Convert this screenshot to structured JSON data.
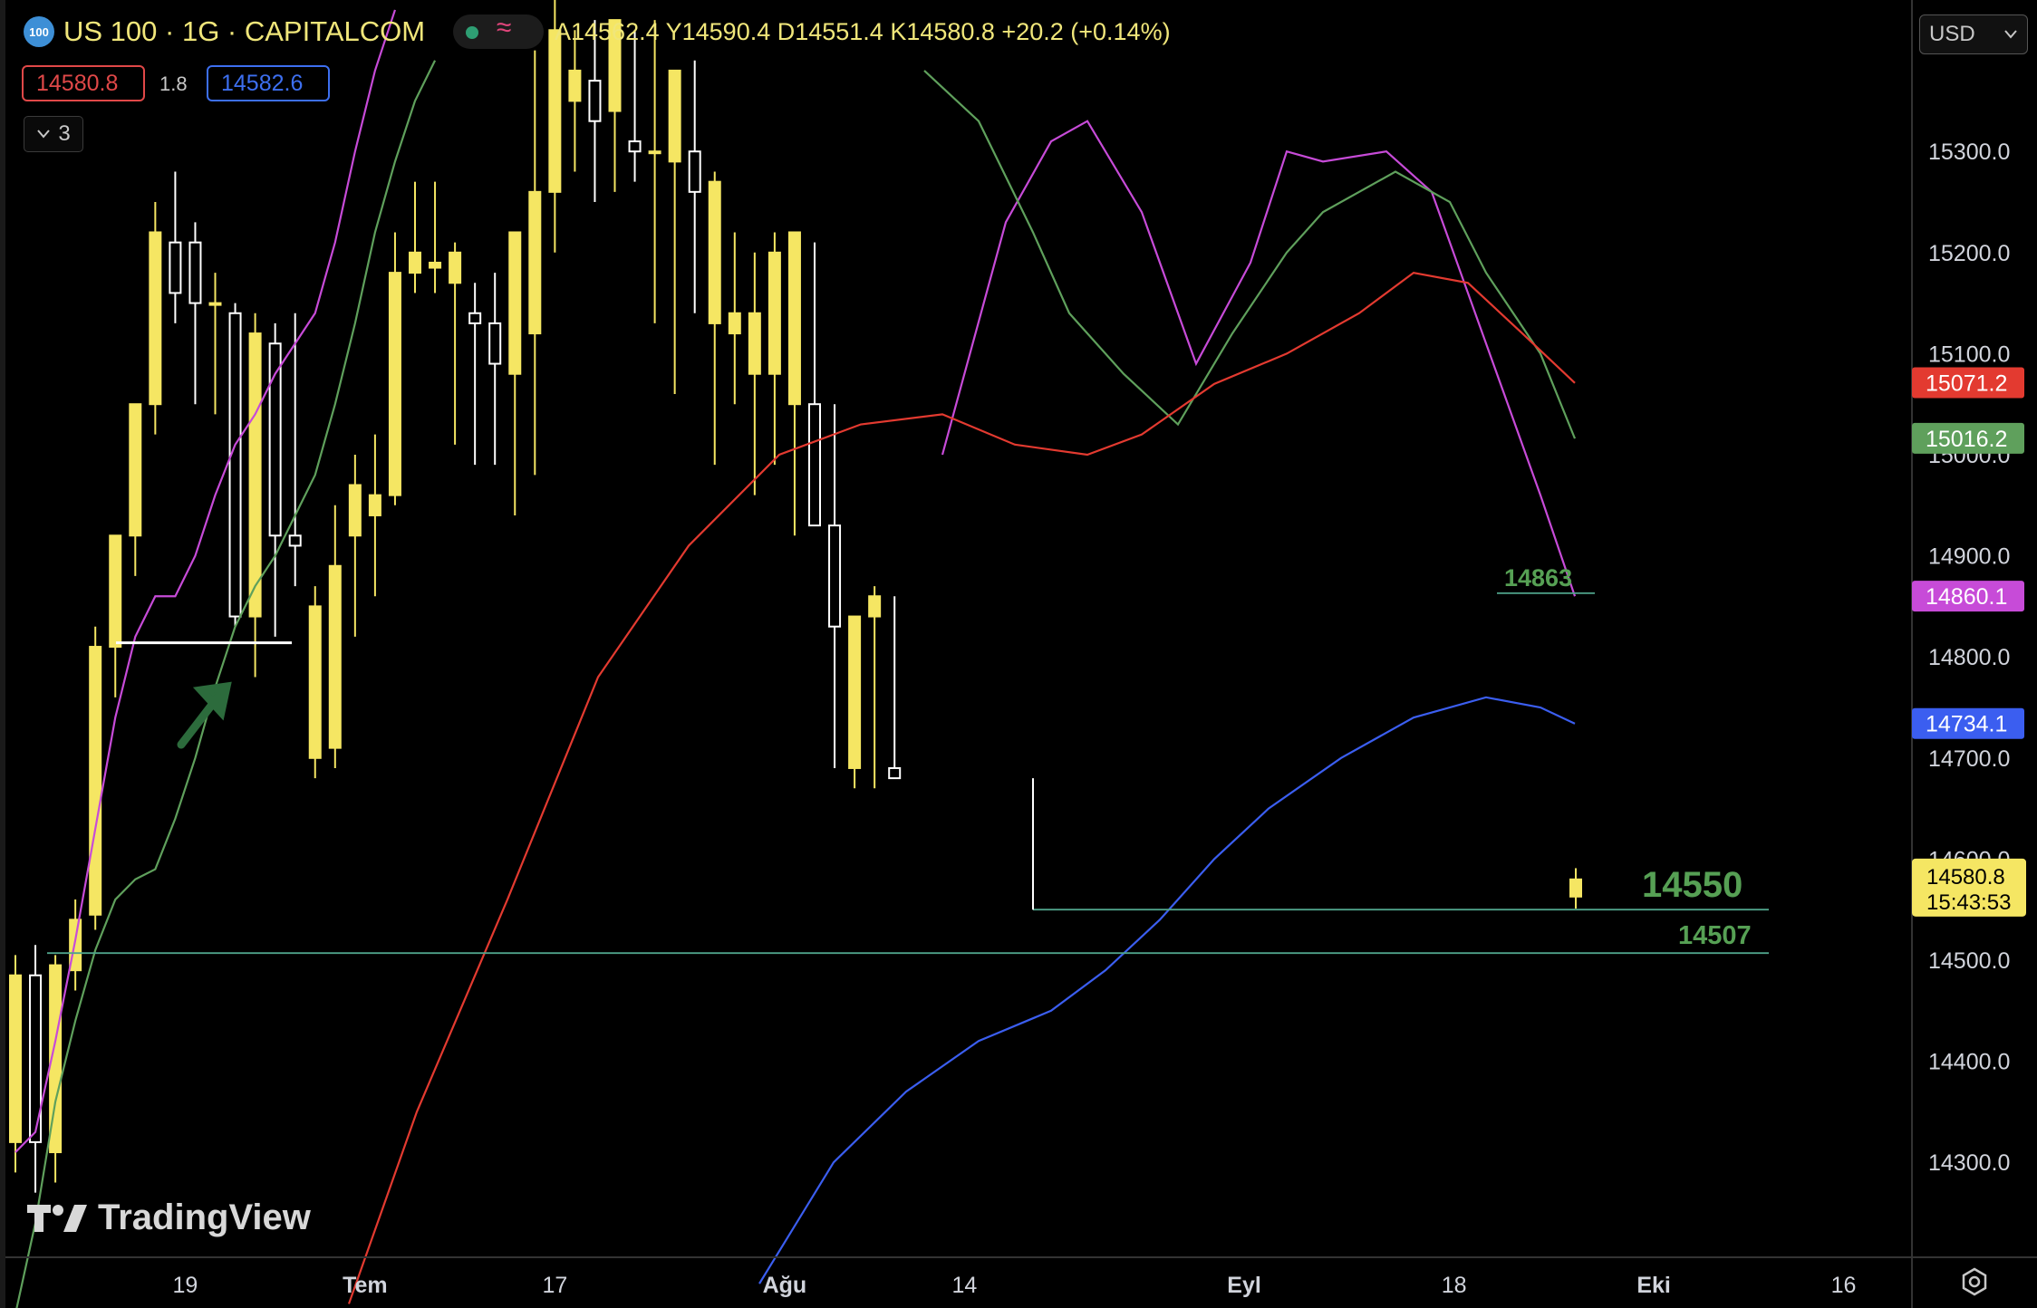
{
  "header": {
    "logo_text": "100",
    "title": "US 100 · 1G · CAPITALCOM",
    "ohlc": "A14562.4  Y14590.4  D14551.4  K14580.8  +20.2 (+0.14%)",
    "bid": "14580.8",
    "spread": "1.8",
    "ask": "14582.6",
    "indicator_count": "3",
    "currency": "USD",
    "brand": "TradingView"
  },
  "colors": {
    "bull": "#f5e663",
    "bear_body": "#000000",
    "wick": "#ffffff",
    "ema_fast": "#c74bd8",
    "ema_mid": "#5fa05c",
    "ema_slow": "#e33a30",
    "ema_long": "#3b5ef0",
    "level": "#4fa38a",
    "label_green": "#56a054"
  },
  "chart_data": {
    "type": "candlestick",
    "symbol": "US 100",
    "timeframe": "1G",
    "y_ticks": [
      14300,
      14400,
      14500,
      14600,
      14700,
      14800,
      14900,
      15000,
      15100,
      15200,
      15300
    ],
    "y_tick_labels": [
      "14300.0",
      "14400.0",
      "14500.0",
      "14600.0",
      "14700.0",
      "14800.0",
      "14900.0",
      "15000.0",
      "15100.0",
      "15200.0",
      "15300.0"
    ],
    "ylim": [
      14204,
      15445
    ],
    "x_labels": [
      {
        "label": "19",
        "bar": 8.5,
        "bold": false
      },
      {
        "label": "Tem",
        "bar": 17.5,
        "bold": true
      },
      {
        "label": "17",
        "bar": 27,
        "bold": false
      },
      {
        "label": "Ağu",
        "bar": 38.5,
        "bold": true
      },
      {
        "label": "14",
        "bar": 47.5,
        "bold": false
      },
      {
        "label": "Eyl",
        "bar": 61.5,
        "bold": true
      },
      {
        "label": "18",
        "bar": 72,
        "bold": false
      },
      {
        "label": "Eki",
        "bar": 82,
        "bold": true
      },
      {
        "label": "16",
        "bar": 91.5,
        "bold": false
      }
    ],
    "candles": [
      [
        14320,
        14505,
        14290,
        14485
      ],
      [
        14485,
        14515,
        14270,
        14320
      ],
      [
        14310,
        14505,
        14280,
        14495
      ],
      [
        14490,
        14560,
        14470,
        14540
      ],
      [
        14545,
        14830,
        14530,
        14810
      ],
      [
        14810,
        14920,
        14760,
        14920
      ],
      [
        14920,
        15050,
        14880,
        15050
      ],
      [
        15050,
        15250,
        15020,
        15220
      ],
      [
        15210,
        15280,
        15130,
        15160
      ],
      [
        15210,
        15230,
        15050,
        15150
      ],
      [
        15150,
        15180,
        15040,
        15150
      ],
      [
        15140,
        15150,
        14830,
        14840
      ],
      [
        14840,
        15140,
        14780,
        15120
      ],
      [
        15110,
        15130,
        14820,
        14920
      ],
      [
        14920,
        15140,
        14870,
        14910
      ],
      [
        14700,
        14870,
        14680,
        14850
      ],
      [
        14710,
        14950,
        14690,
        14890
      ],
      [
        14920,
        15000,
        14820,
        14970
      ],
      [
        14940,
        15020,
        14860,
        14960
      ],
      [
        14960,
        15220,
        14950,
        15180
      ],
      [
        15180,
        15270,
        15160,
        15200
      ],
      [
        15185,
        15270,
        15160,
        15190
      ],
      [
        15170,
        15210,
        15010,
        15200
      ],
      [
        15140,
        15170,
        14990,
        15130
      ],
      [
        15130,
        15180,
        14990,
        15090
      ],
      [
        15080,
        15220,
        14940,
        15220
      ],
      [
        15120,
        15400,
        14980,
        15260
      ],
      [
        15260,
        15520,
        15200,
        15420
      ]
    ],
    "candles_mid": [
      [
        15350,
        15420,
        15280,
        15380
      ],
      [
        15370,
        15430,
        15250,
        15330
      ],
      [
        15340,
        15430,
        15260,
        15430
      ],
      [
        15310,
        15420,
        15270,
        15300
      ],
      [
        15300,
        15430,
        15130,
        15300
      ],
      [
        15290,
        15370,
        15060,
        15380
      ],
      [
        15300,
        15390,
        15140,
        15260
      ],
      [
        15130,
        15280,
        14990,
        15270
      ],
      [
        15120,
        15220,
        15050,
        15140
      ],
      [
        15080,
        15200,
        14960,
        15140
      ],
      [
        15080,
        15220,
        14990,
        15200
      ],
      [
        15050,
        15200,
        14920,
        15220
      ],
      [
        15050,
        15210,
        14960,
        14930
      ],
      [
        14930,
        15050,
        14690,
        14830
      ],
      [
        14690,
        14830,
        14670,
        14840
      ],
      [
        14840,
        14870,
        14670,
        14860
      ],
      [
        14690,
        14860,
        14680,
        14680
      ]
    ],
    "levels": [
      {
        "label": "14863",
        "value": 14863
      },
      {
        "label": "14550",
        "value": 14550
      },
      {
        "label": "14507",
        "value": 14507
      }
    ],
    "price_tags": [
      {
        "label": "15071.2",
        "value": 15071.2,
        "color": "#e33a30"
      },
      {
        "label": "15016.2",
        "value": 15016.2,
        "color": "#5fa05c"
      },
      {
        "label": "14860.1",
        "value": 14860.1,
        "color": "#c74bd8"
      },
      {
        "label": "14734.1",
        "value": 14734.1,
        "color": "#3b5ef0"
      }
    ],
    "last_price": {
      "label": "14580.8",
      "value": 14580.8,
      "countdown": "15:43:53"
    }
  }
}
